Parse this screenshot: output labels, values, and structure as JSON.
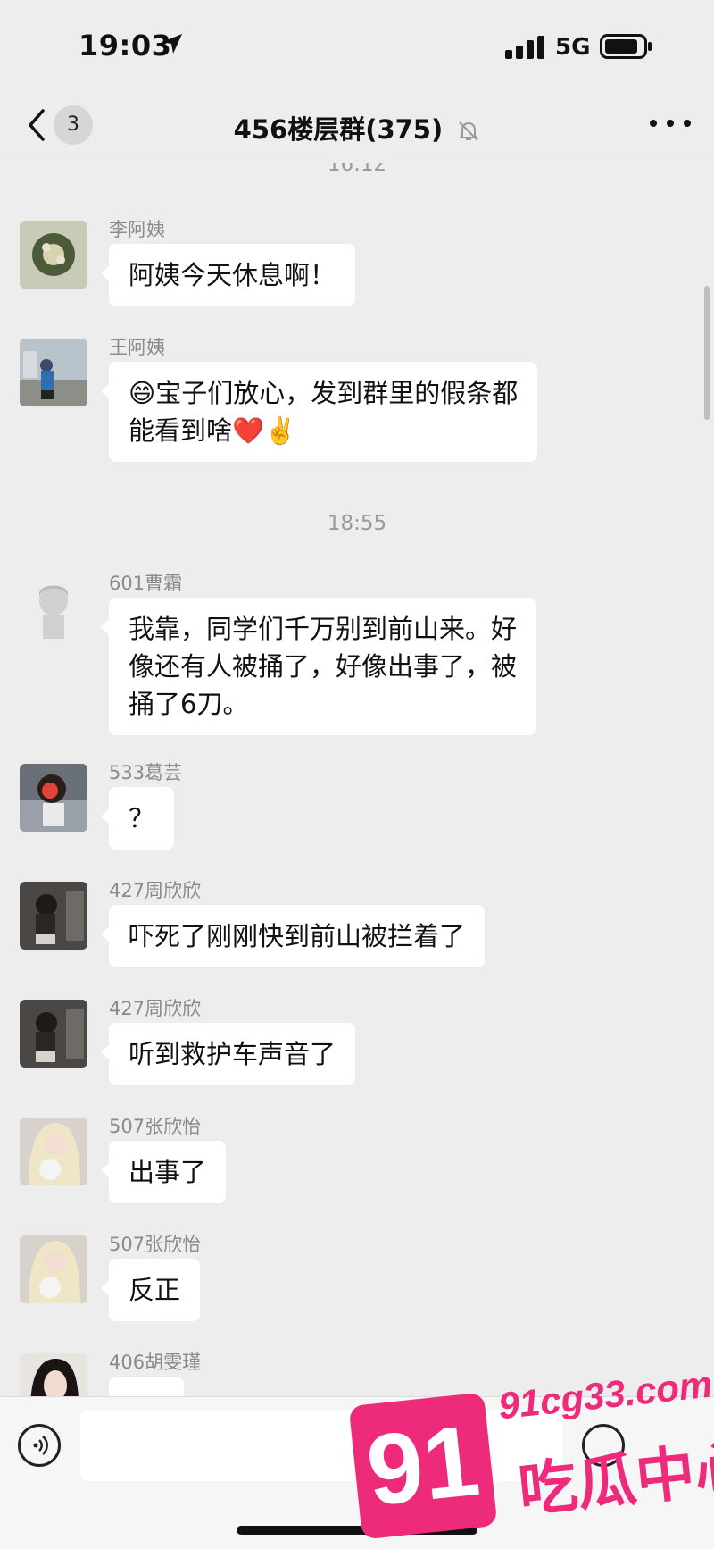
{
  "status": {
    "time": "19:03",
    "network": "5G"
  },
  "nav": {
    "badge": "3",
    "title": "456楼层群(375)"
  },
  "timestamps": [
    "16:12",
    "18:55"
  ],
  "messages": [
    {
      "sender": "李阿姨",
      "text": "阿姨今天休息啊！"
    },
    {
      "sender": "王阿姨",
      "line1": "😄宝子们放心，发到群里的假条都",
      "line2": "能看到啥❤️✌️"
    },
    {
      "sender": "601曹霜",
      "line1": "我靠，同学们千万别到前山来。好",
      "line2": "像还有人被捅了，好像出事了，被",
      "line3": "捅了6刀。"
    },
    {
      "sender": "533葛芸",
      "text": "？"
    },
    {
      "sender": "427周欣欣",
      "text": "吓死了刚刚快到前山被拦着了"
    },
    {
      "sender": "427周欣欣",
      "text": "听到救护车声音了"
    },
    {
      "sender": "507张欣怡",
      "text": "出事了"
    },
    {
      "sender": "507张欣怡",
      "text": "反正"
    },
    {
      "sender": "406胡雯瑾",
      "text": ""
    }
  ],
  "watermark": {
    "number": "91",
    "url": "91cg33.com",
    "name": "吃瓜中心"
  },
  "colors": {
    "background": "#ededed",
    "bubble": "#ffffff",
    "watermark": "#ee2a7b"
  }
}
